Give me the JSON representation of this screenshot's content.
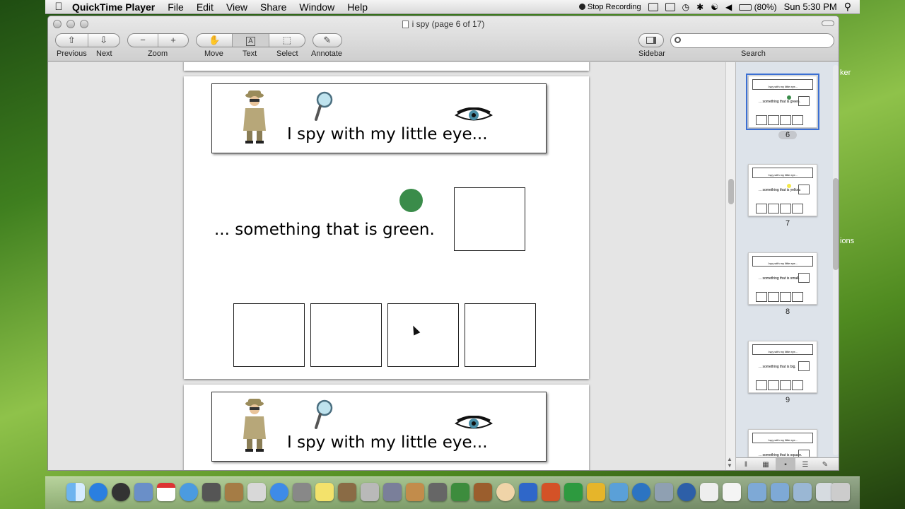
{
  "menubar": {
    "app_name": "QuickTime Player",
    "menus": [
      "File",
      "Edit",
      "View",
      "Share",
      "Window",
      "Help"
    ],
    "stop_recording": "Stop Recording",
    "battery": "(80%)",
    "clock": "Sun 5:30 PM"
  },
  "window": {
    "title": "i spy (page 6 of 17)"
  },
  "toolbar": {
    "previous": "Previous",
    "next": "Next",
    "zoom": "Zoom",
    "move": "Move",
    "text": "Text",
    "select": "Select",
    "annotate": "Annotate",
    "sidebar": "Sidebar",
    "search": "Search",
    "text_tool_glyph": "A"
  },
  "document": {
    "banner_text": "I spy with my little eye...",
    "prompt_text": "... something that is green.",
    "accent_color": "#3a8c4a"
  },
  "sidebar": {
    "pages": [
      {
        "number": "6",
        "prompt": "... something that is green.",
        "dot_color": "#3a8c4a",
        "selected": true
      },
      {
        "number": "7",
        "prompt": "... something that is yellow.",
        "dot_color": "#f3e84a",
        "selected": false
      },
      {
        "number": "8",
        "prompt": "... something that is small.",
        "dot_color": "",
        "selected": false
      },
      {
        "number": "9",
        "prompt": "... something that is big.",
        "dot_color": "",
        "selected": false
      },
      {
        "number": "",
        "prompt": "... something that is square.",
        "dot_color": "",
        "selected": false
      }
    ]
  },
  "desktop": {
    "edge_label_1": "ker",
    "edge_label_2": "ions"
  }
}
